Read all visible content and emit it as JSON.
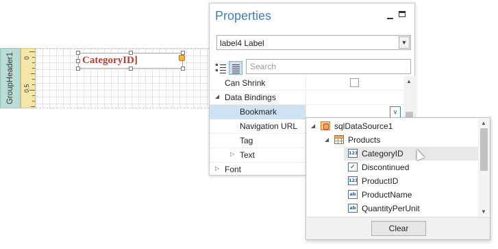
{
  "designer": {
    "band_name": "GroupHeader1",
    "ruler_marks": [
      "0",
      "0.5"
    ],
    "label_text": "CategoryID]"
  },
  "properties": {
    "title": "Properties",
    "object_selector": "label4  Label",
    "search_placeholder": "Search",
    "rows": [
      {
        "name": "Can Shrink"
      },
      {
        "name": "Data Bindings"
      },
      {
        "name": "Bookmark"
      },
      {
        "name": "Navigation URL"
      },
      {
        "name": "Tag"
      },
      {
        "name": "Text"
      },
      {
        "name": "Font"
      }
    ]
  },
  "binding_popup": {
    "tree": [
      {
        "label": "sqlDataSource1",
        "icon": "data-source-icon"
      },
      {
        "label": "Products",
        "icon": "table-icon"
      },
      {
        "label": "CategoryID",
        "icon": "number-field-icon"
      },
      {
        "label": "Discontinued",
        "icon": "boolean-field-icon"
      },
      {
        "label": "ProductID",
        "icon": "number-field-icon"
      },
      {
        "label": "ProductName",
        "icon": "string-field-icon"
      },
      {
        "label": "QuantityPerUnit",
        "icon": "string-field-icon"
      }
    ],
    "clear_label": "Clear"
  },
  "icons": {
    "number": "123",
    "string": "ab",
    "boolean": "✓"
  },
  "colors": {
    "panel_title": "#3f7fbf",
    "band_tab": "#b9dcd6",
    "ruler": "#f4e6a9",
    "label_text": "#c0392b",
    "selected_row": "#cde3f3"
  }
}
